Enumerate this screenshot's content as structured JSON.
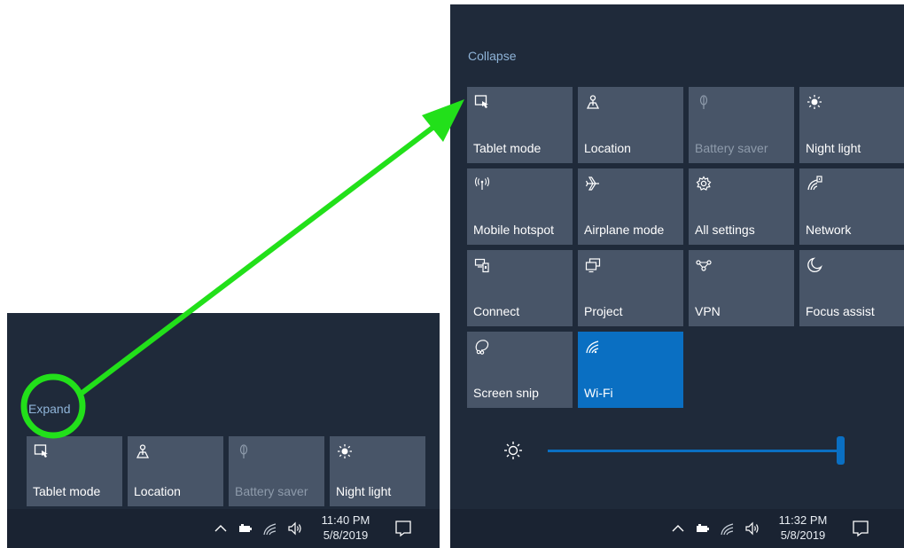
{
  "left_panel": {
    "expand_label": "Expand",
    "tiles": [
      {
        "label": "Tablet mode",
        "icon": "tablet-mode-icon",
        "state": "normal"
      },
      {
        "label": "Location",
        "icon": "location-icon",
        "state": "normal"
      },
      {
        "label": "Battery saver",
        "icon": "battery-saver-icon",
        "state": "disabled"
      },
      {
        "label": "Night light",
        "icon": "night-light-icon",
        "state": "normal"
      }
    ],
    "taskbar": {
      "time": "11:40 PM",
      "date": "5/8/2019"
    }
  },
  "right_panel": {
    "collapse_label": "Collapse",
    "tiles": [
      {
        "label": "Tablet mode",
        "icon": "tablet-mode-icon",
        "state": "normal"
      },
      {
        "label": "Location",
        "icon": "location-icon",
        "state": "normal"
      },
      {
        "label": "Battery saver",
        "icon": "battery-saver-icon",
        "state": "disabled"
      },
      {
        "label": "Night light",
        "icon": "night-light-icon",
        "state": "normal"
      },
      {
        "label": "Mobile hotspot",
        "icon": "mobile-hotspot-icon",
        "state": "normal"
      },
      {
        "label": "Airplane mode",
        "icon": "airplane-icon",
        "state": "normal"
      },
      {
        "label": "All settings",
        "icon": "gear-icon",
        "state": "normal"
      },
      {
        "label": "Network",
        "icon": "network-icon",
        "state": "normal"
      },
      {
        "label": "Connect",
        "icon": "connect-icon",
        "state": "normal"
      },
      {
        "label": "Project",
        "icon": "project-icon",
        "state": "normal"
      },
      {
        "label": "VPN",
        "icon": "vpn-icon",
        "state": "normal"
      },
      {
        "label": "Focus assist",
        "icon": "moon-icon",
        "state": "normal"
      },
      {
        "label": "Screen snip",
        "icon": "screen-snip-icon",
        "state": "normal"
      },
      {
        "label": "Wi-Fi",
        "icon": "wifi-icon",
        "state": "active"
      }
    ],
    "brightness_level": 1.0,
    "taskbar": {
      "time": "11:32 PM",
      "date": "5/8/2019"
    }
  },
  "colors": {
    "panel_bg": "#1f2a3a",
    "tile_bg": "#485568",
    "tile_active": "#0a6fc2",
    "link": "#8fb4d8",
    "annotation": "#22e01a"
  }
}
